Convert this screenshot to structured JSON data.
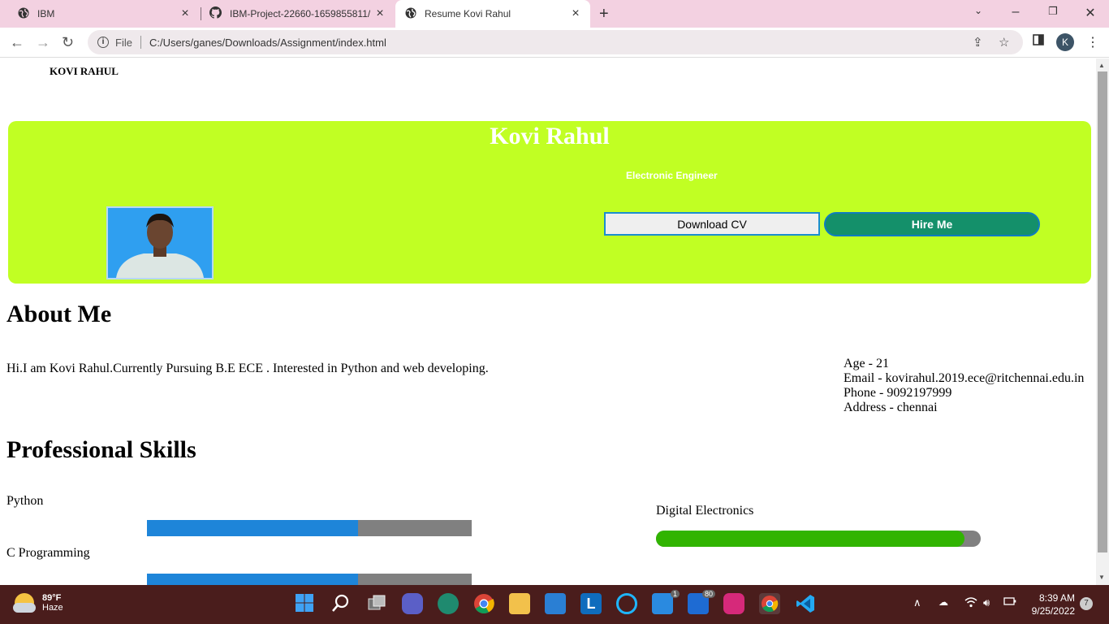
{
  "browser": {
    "tabs": [
      {
        "title": "IBM",
        "icon": "globe-icon",
        "active": false
      },
      {
        "title": "IBM-Project-22660-1659855811/",
        "icon": "github-icon",
        "active": false
      },
      {
        "title": "Resume Kovi Rahul",
        "icon": "globe-icon",
        "active": true
      }
    ],
    "address_prefix": "File",
    "address": "C:/Users/ganes/Downloads/Assignment/index.html",
    "profile_initial": "K"
  },
  "page": {
    "brand": "KOVI RAHUL",
    "hero": {
      "name": "Kovi Rahul",
      "subtitle": "Electronic Engineer",
      "download_button": "Download CV",
      "hire_button": "Hire Me",
      "background_color": "#c1ff23"
    },
    "about": {
      "heading": "About Me",
      "text": "Hi.I am Kovi Rahul.Currently Pursuing B.E ECE . Interested in Python and web developing.",
      "age": "Age -  21",
      "email": "Email -  kovirahul.2019.ece@ritchennai.edu.in",
      "phone": "Phone -  9092197999",
      "address": "Address - chennai"
    },
    "skills": {
      "heading": "Professional Skills",
      "items": [
        {
          "name": "Python",
          "level": 0.65,
          "color": "#1e85d9"
        },
        {
          "name": "C Programming",
          "level": 0.65,
          "color": "#1e85d9"
        },
        {
          "name": "Digital Electronics",
          "level": 0.95,
          "color": "#31b401"
        }
      ]
    }
  },
  "taskbar": {
    "weather_temp": "89°F",
    "weather_desc": "Haze",
    "mail_badge": "1",
    "store_badge": "80",
    "time": "8:39 AM",
    "date": "9/25/2022",
    "notifications": "7"
  }
}
